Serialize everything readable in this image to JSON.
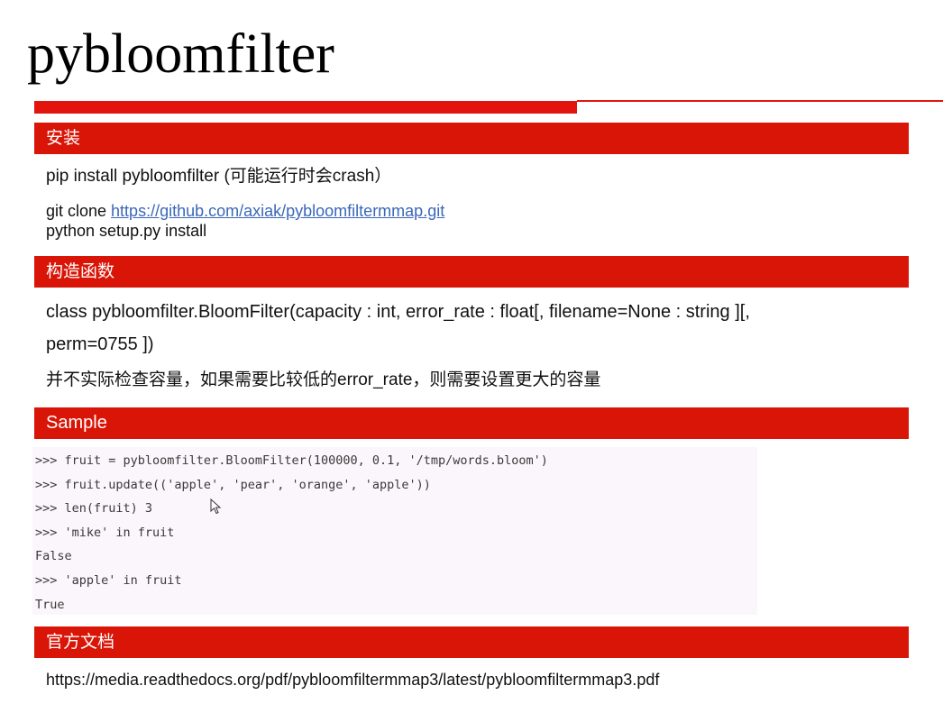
{
  "slide": {
    "title": "pybloomfilter"
  },
  "install": {
    "heading": "安装",
    "line1": "pip install pybloomfilter (可能运行时会crash）",
    "line2_prefix": "git clone ",
    "line2_link": "https://github.com/axiak/pybloomfiltermmap.git",
    "line3": "python setup.py install"
  },
  "constructor": {
    "heading": "构造函数",
    "signature_line1": "class pybloomfilter.BloomFilter(capacity : int, error_rate : float[, filename=None : string ][,",
    "signature_line2": "perm=0755 ])",
    "note": "并不实际检查容量，如果需要比较低的error_rate，则需要设置更大的容量"
  },
  "sample": {
    "heading": "Sample",
    "lines": [
      ">>> fruit = pybloomfilter.BloomFilter(100000, 0.1, '/tmp/words.bloom')",
      ">>> fruit.update(('apple', 'pear', 'orange', 'apple'))",
      ">>> len(fruit) 3",
      ">>> 'mike' in fruit",
      "False",
      ">>> 'apple' in fruit",
      "True"
    ]
  },
  "docs": {
    "heading": "官方文档",
    "url": "https://media.readthedocs.org/pdf/pybloomfiltermmap3/latest/pybloomfiltermmap3.pdf"
  },
  "colors": {
    "accent_red": "#d91507",
    "link_blue": "#3a67b8",
    "code_bg": "#fbf6fb"
  },
  "icons": {
    "cursor": "mouse-pointer-icon"
  }
}
